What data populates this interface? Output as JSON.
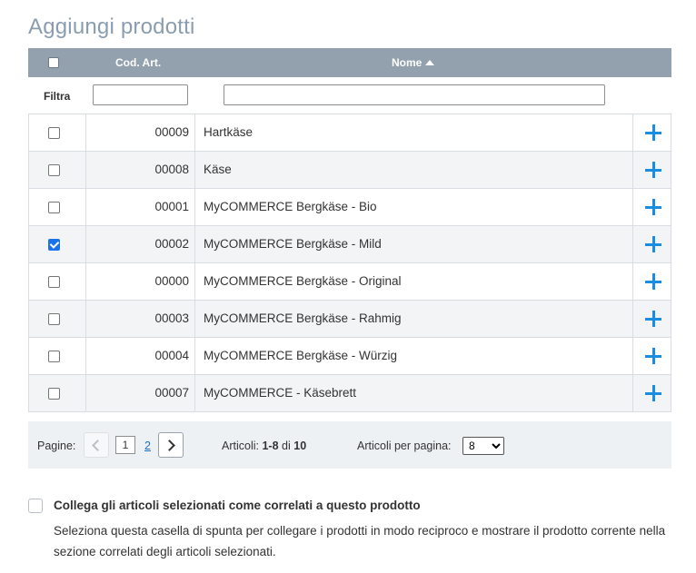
{
  "title": "Aggiungi prodotti",
  "header": {
    "code_label": "Cod. Art.",
    "name_label": "Nome",
    "sort": "ascending"
  },
  "filter": {
    "label": "Filtra",
    "code_value": "",
    "name_value": ""
  },
  "rows": [
    {
      "code": "00009",
      "name": "Hartkäse",
      "checked": false
    },
    {
      "code": "00008",
      "name": "Käse",
      "checked": false
    },
    {
      "code": "00001",
      "name": "MyCOMMERCE Bergkäse - Bio",
      "checked": false
    },
    {
      "code": "00002",
      "name": "MyCOMMERCE Bergkäse - Mild",
      "checked": true
    },
    {
      "code": "00000",
      "name": "MyCOMMERCE Bergkäse - Original",
      "checked": false
    },
    {
      "code": "00003",
      "name": "MyCOMMERCE Bergkäse - Rahmig",
      "checked": false
    },
    {
      "code": "00004",
      "name": "MyCOMMERCE Bergkäse - Würzig",
      "checked": false
    },
    {
      "code": "00007",
      "name": "MyCOMMERCE - Käsebrett",
      "checked": false
    }
  ],
  "pager": {
    "pages_label": "Pagine:",
    "current_page": "1",
    "next_page": "2",
    "articles_prefix": "Articoli:",
    "articles_range": "1-8",
    "articles_of": "di",
    "articles_total": "10",
    "per_page_label": "Articoli per pagina:",
    "per_page_value": "8"
  },
  "link_option": {
    "checked": false,
    "title": "Collega gli articoli selezionati come correlati a questo prodotto",
    "description": "Seleziona questa casella di spunta per collegare i prodotti in modo reciproco e mostrare il prodotto corrente nella sezione correlati degli articoli selezionati."
  },
  "colors": {
    "accent": "#1b8de0",
    "header_bg": "#93a1ae",
    "title": "#8a9db0"
  }
}
